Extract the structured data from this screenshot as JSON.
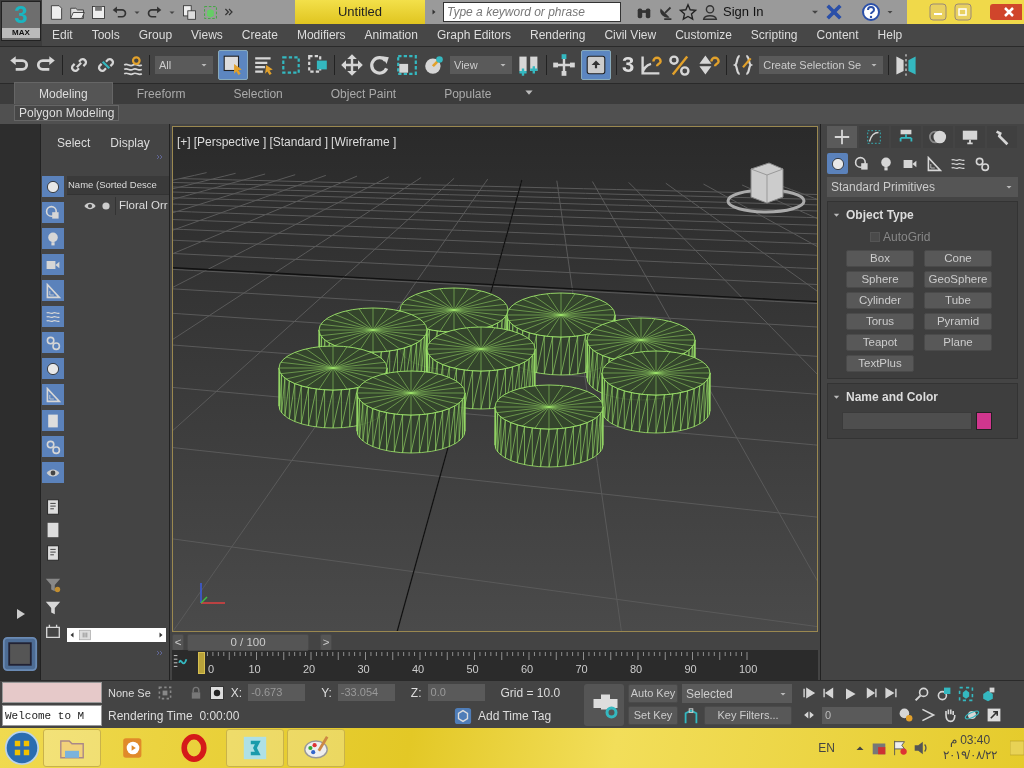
{
  "logo": {
    "number": "3",
    "label": "MAX"
  },
  "title_bar": {
    "title": "Untitled",
    "search": {
      "placeholder": "Type a keyword or phrase"
    },
    "sign_in": "Sign In"
  },
  "menu": [
    "Edit",
    "Tools",
    "Group",
    "Views",
    "Create",
    "Modifiers",
    "Animation",
    "Graph Editors",
    "Rendering",
    "Civil View",
    "Customize",
    "Scripting",
    "Content",
    "Help"
  ],
  "main_toolbar": {
    "selection_filter": "All",
    "select_object_active": true,
    "reference_coordinate_system": "View",
    "keyboard_override_active": true,
    "snaps_toggle": "3",
    "named_selection_set": "Create Selection Se"
  },
  "ribbon": {
    "tabs": [
      {
        "label": "Modeling",
        "selected": true
      },
      {
        "label": "Freeform",
        "selected": false
      },
      {
        "label": "Selection",
        "selected": false
      },
      {
        "label": "Object Paint",
        "selected": false
      },
      {
        "label": "Populate",
        "selected": false
      }
    ],
    "panel_title": "Polygon Modeling"
  },
  "scene_explorer": {
    "tabs": [
      "Select",
      "Display"
    ],
    "column": "Name (Sorted Desce",
    "items": [
      {
        "name": "Floral Orr"
      }
    ]
  },
  "viewport": {
    "labels": [
      "[+]",
      "[Perspective ]",
      "[Standard ]",
      "[Wireframe ]"
    ]
  },
  "time_slider": {
    "prev": "<",
    "position": "0 / 100",
    "next": ">",
    "level": 0
  },
  "track_bar": {
    "ticks": [
      "0",
      "10",
      "20",
      "30",
      "40",
      "50",
      "60",
      "70",
      "80",
      "90",
      "100"
    ]
  },
  "command_panel": {
    "tabs": [
      {
        "selected": true
      },
      {
        "selected": false
      },
      {
        "selected": false
      },
      {
        "selected": false
      },
      {
        "selected": false
      },
      {
        "selected": false
      }
    ],
    "categories": [
      {
        "selected": true
      },
      {
        "selected": false
      },
      {
        "selected": false
      },
      {
        "selected": false
      },
      {
        "selected": false
      },
      {
        "selected": false
      },
      {
        "selected": false
      }
    ],
    "category_dropdown": "Standard Primitives",
    "object_type": {
      "title": "Object Type",
      "expanded": true,
      "autogrid": {
        "label": "AutoGrid",
        "checked": false
      },
      "buttons": [
        "Box",
        "Cone",
        "Sphere",
        "GeoSphere",
        "Cylinder",
        "Tube",
        "Torus",
        "Pyramid",
        "Teapot",
        "Plane",
        "TextPlus"
      ]
    },
    "name_and_color": {
      "title": "Name and Color",
      "expanded": true,
      "color": "#d0368e"
    }
  },
  "status_bar": {
    "listener_output": "Welcome to M",
    "selection": "None Se",
    "coords": [
      {
        "axis": "X:",
        "value": "-0.673"
      },
      {
        "axis": "Y:",
        "value": "-33.054"
      },
      {
        "axis": "Z:",
        "value": "0.0"
      }
    ],
    "grid": "Grid = 10.0",
    "prompt": "Rendering Time  0:00:00",
    "add_time_tag": "Add Time Tag"
  },
  "animation": {
    "auto_key": "Auto Key",
    "key_mode": "Selected",
    "set_key": "Set Key",
    "key_filters": "Key Filters...",
    "frame": "0"
  },
  "taskbar": {
    "language": "EN",
    "time": "03:40 م",
    "date": "٢٠١٩/٠٨/٢٢"
  }
}
